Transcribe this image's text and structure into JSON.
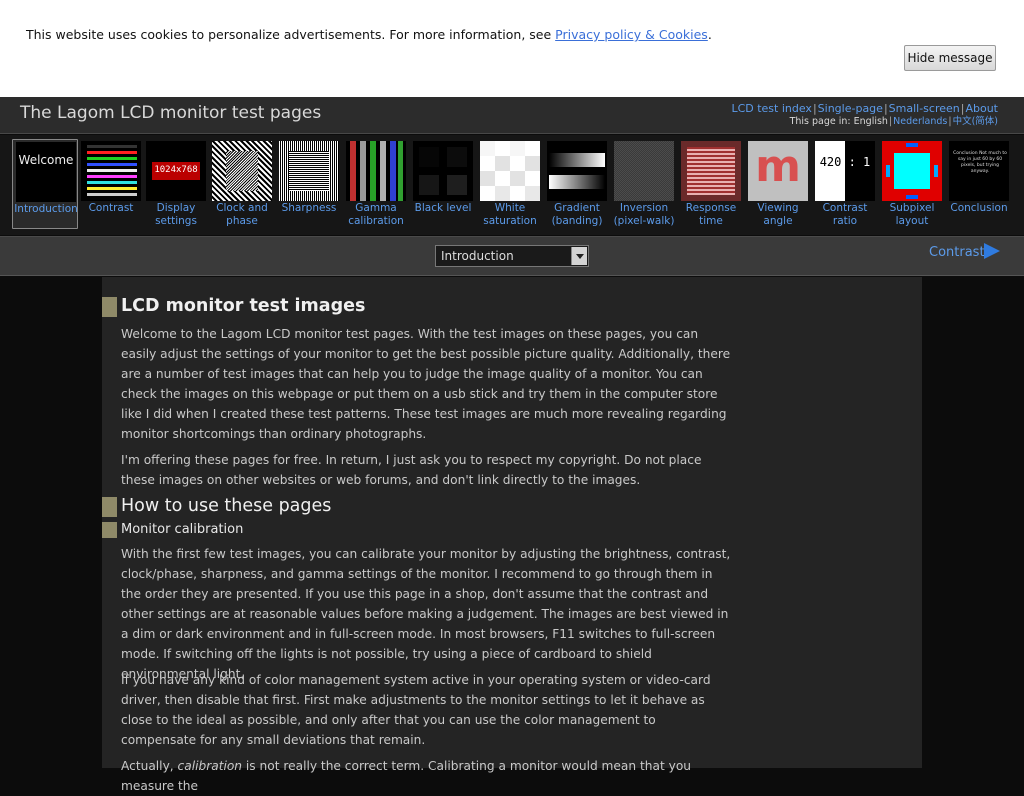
{
  "cookie": {
    "text": "This website uses cookies to personalize advertisements. For more information, see ",
    "link": "Privacy policy & Cookies",
    "end": ".",
    "button": "Hide message"
  },
  "header": {
    "title": "The Lagom LCD monitor test pages",
    "links": [
      "LCD test index",
      "Single-page",
      "Small-screen",
      "About"
    ],
    "language_prefix": "This page in: English",
    "languages": [
      "Nederlands",
      "中文(简体)"
    ]
  },
  "tabs": [
    {
      "label": [
        "Introduction"
      ],
      "icon": "welcome-thumbnail",
      "active": true,
      "thumb_text": "Welcome"
    },
    {
      "label": [
        "Contrast"
      ],
      "icon": "contrast-thumbnail"
    },
    {
      "label": [
        "Display",
        "settings"
      ],
      "icon": "display-settings-thumbnail",
      "thumb_text": "1024x768"
    },
    {
      "label": [
        "Clock and",
        "phase"
      ],
      "icon": "clock-phase-thumbnail"
    },
    {
      "label": [
        "Sharpness"
      ],
      "icon": "sharpness-thumbnail"
    },
    {
      "label": [
        "Gamma",
        "calibration"
      ],
      "icon": "gamma-thumbnail"
    },
    {
      "label": [
        "Black level"
      ],
      "icon": "black-level-thumbnail"
    },
    {
      "label": [
        "White",
        "saturation"
      ],
      "icon": "white-saturation-thumbnail"
    },
    {
      "label": [
        "Gradient",
        "(banding)"
      ],
      "icon": "gradient-thumbnail"
    },
    {
      "label": [
        "Inversion",
        "(pixel-walk)"
      ],
      "icon": "inversion-thumbnail"
    },
    {
      "label": [
        "Response",
        "time"
      ],
      "icon": "response-time-thumbnail"
    },
    {
      "label": [
        "Viewing",
        "angle"
      ],
      "icon": "viewing-angle-thumbnail",
      "thumb_text": "m"
    },
    {
      "label": [
        "Contrast",
        "ratio"
      ],
      "icon": "contrast-ratio-thumbnail",
      "thumb_text": "420 : 1"
    },
    {
      "label": [
        "Subpixel",
        "layout"
      ],
      "icon": "subpixel-thumbnail"
    },
    {
      "label": [
        "Conclusion"
      ],
      "icon": "conclusion-thumbnail",
      "thumb_text": "Conclusion Not much to say in just 60 by 60 pixels, but trying anyway."
    }
  ],
  "nav": {
    "select_value": "Introduction",
    "next_label": "Contrast",
    "next_icon": "play-arrow-icon"
  },
  "content": {
    "h1": "LCD monitor test images",
    "p1": "Welcome to the Lagom LCD monitor test pages. With the test images on these pages, you can easily adjust the settings of your monitor to get the best possible picture quality. Additionally, there are a number of test images that can help you to judge the image quality of a monitor. You can check the images on this webpage or put them on a usb stick and try them in the computer store like I did when I created these test patterns. These test images are much more revealing regarding monitor shortcomings than ordinary photographs.",
    "p2": "I'm offering these pages for free. In return, I just ask you to respect my copyright. Do not place these images on other websites or web forums, and don't link directly to the images.",
    "h2": "How to use these pages",
    "h3": "Monitor calibration",
    "p3": "With the first few test images, you can calibrate your monitor by adjusting the brightness, contrast, clock/phase, sharpness, and gamma settings of the monitor. I recommend to go through them in the order they are presented. If you use this page in a shop, don't assume that the contrast and other settings are at reasonable values before making a judgement. The images are best viewed in a dim or dark environment and in full-screen mode. In most browsers, F11 switches to full-screen mode. If switching off the lights is not possible, try using a piece of cardboard to shield environmental light.",
    "p4": "If you have any kind of color management system active in your operating system or video-card driver, then disable that first. First make adjustments to the monitor settings to let it behave as close to the ideal as possible, and only after that you can use the color management to compensate for any small deviations that remain.",
    "p5_start": "Actually, ",
    "p5_em": "calibration",
    "p5_rest": " is not really the correct term. Calibrating a monitor would mean that you measure the"
  },
  "colors": {
    "accent_link": "#5c9bea",
    "heading_marker": "#8f8a68",
    "header_bg": "#2c2c2c",
    "content_bg": "#242424"
  }
}
